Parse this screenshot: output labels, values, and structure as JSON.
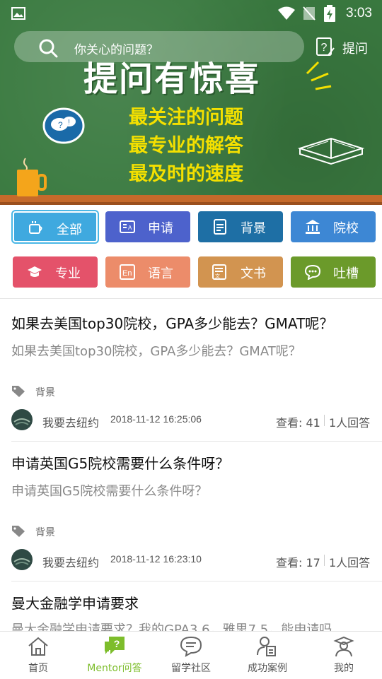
{
  "status_bar": {
    "time": "3:03"
  },
  "banner": {
    "search_placeholder": "你关心的问题？",
    "ask_label": "提问",
    "headline": "提问有惊喜",
    "slogans": [
      "最关注的问题",
      "最专业的解答",
      "最及时的速度"
    ]
  },
  "categories": [
    {
      "label": "全部",
      "color": "#3fa9df",
      "icon": "cup-icon",
      "selected": true
    },
    {
      "label": "申请",
      "color": "#4d62cc",
      "icon": "id-card-icon"
    },
    {
      "label": "背景",
      "color": "#1e6fa5",
      "icon": "document-icon"
    },
    {
      "label": "院校",
      "color": "#3d87d4",
      "icon": "institution-icon"
    },
    {
      "label": "专业",
      "color": "#e4526a",
      "icon": "graduation-cap-icon"
    },
    {
      "label": "语言",
      "color": "#ec8c6a",
      "icon": "language-en-icon"
    },
    {
      "label": "文书",
      "color": "#d29450",
      "icon": "essay-icon"
    },
    {
      "label": "吐槽",
      "color": "#6b9a2a",
      "icon": "chat-bubble-icon"
    }
  ],
  "questions": [
    {
      "title": "如果去美国top30院校，GPA多少能去？GMAT呢？",
      "desc": "如果去美国top30院校，GPA多少能去？GMAT呢？",
      "tag": "背景",
      "user": "我要去纽约",
      "time": "2018-11-12 16:25:06",
      "views": "查看: 41",
      "answers": "1人回答"
    },
    {
      "title": "申请英国G5院校需要什么条件呀？",
      "desc": "申请英国G5院校需要什么条件呀？",
      "tag": "背景",
      "user": "我要去纽约",
      "time": "2018-11-12 16:23:10",
      "views": "查看: 17",
      "answers": "1人回答"
    },
    {
      "title": "曼大金融学申请要求",
      "desc": "曼大金融学申请要求？我的GPA3.6，雅思7.5，能申请吗"
    }
  ],
  "bottom_nav": [
    {
      "label": "首页",
      "icon": "home-icon"
    },
    {
      "label": "Mentor问答",
      "icon": "question-bubble-icon",
      "active": true
    },
    {
      "label": "留学社区",
      "icon": "message-icon"
    },
    {
      "label": "成功案例",
      "icon": "user-document-icon"
    },
    {
      "label": "我的",
      "icon": "graduate-user-icon"
    }
  ],
  "colors": {
    "accent": "#7dbd2b",
    "banner": "#3a7a40",
    "slogan": "#f4e000"
  }
}
